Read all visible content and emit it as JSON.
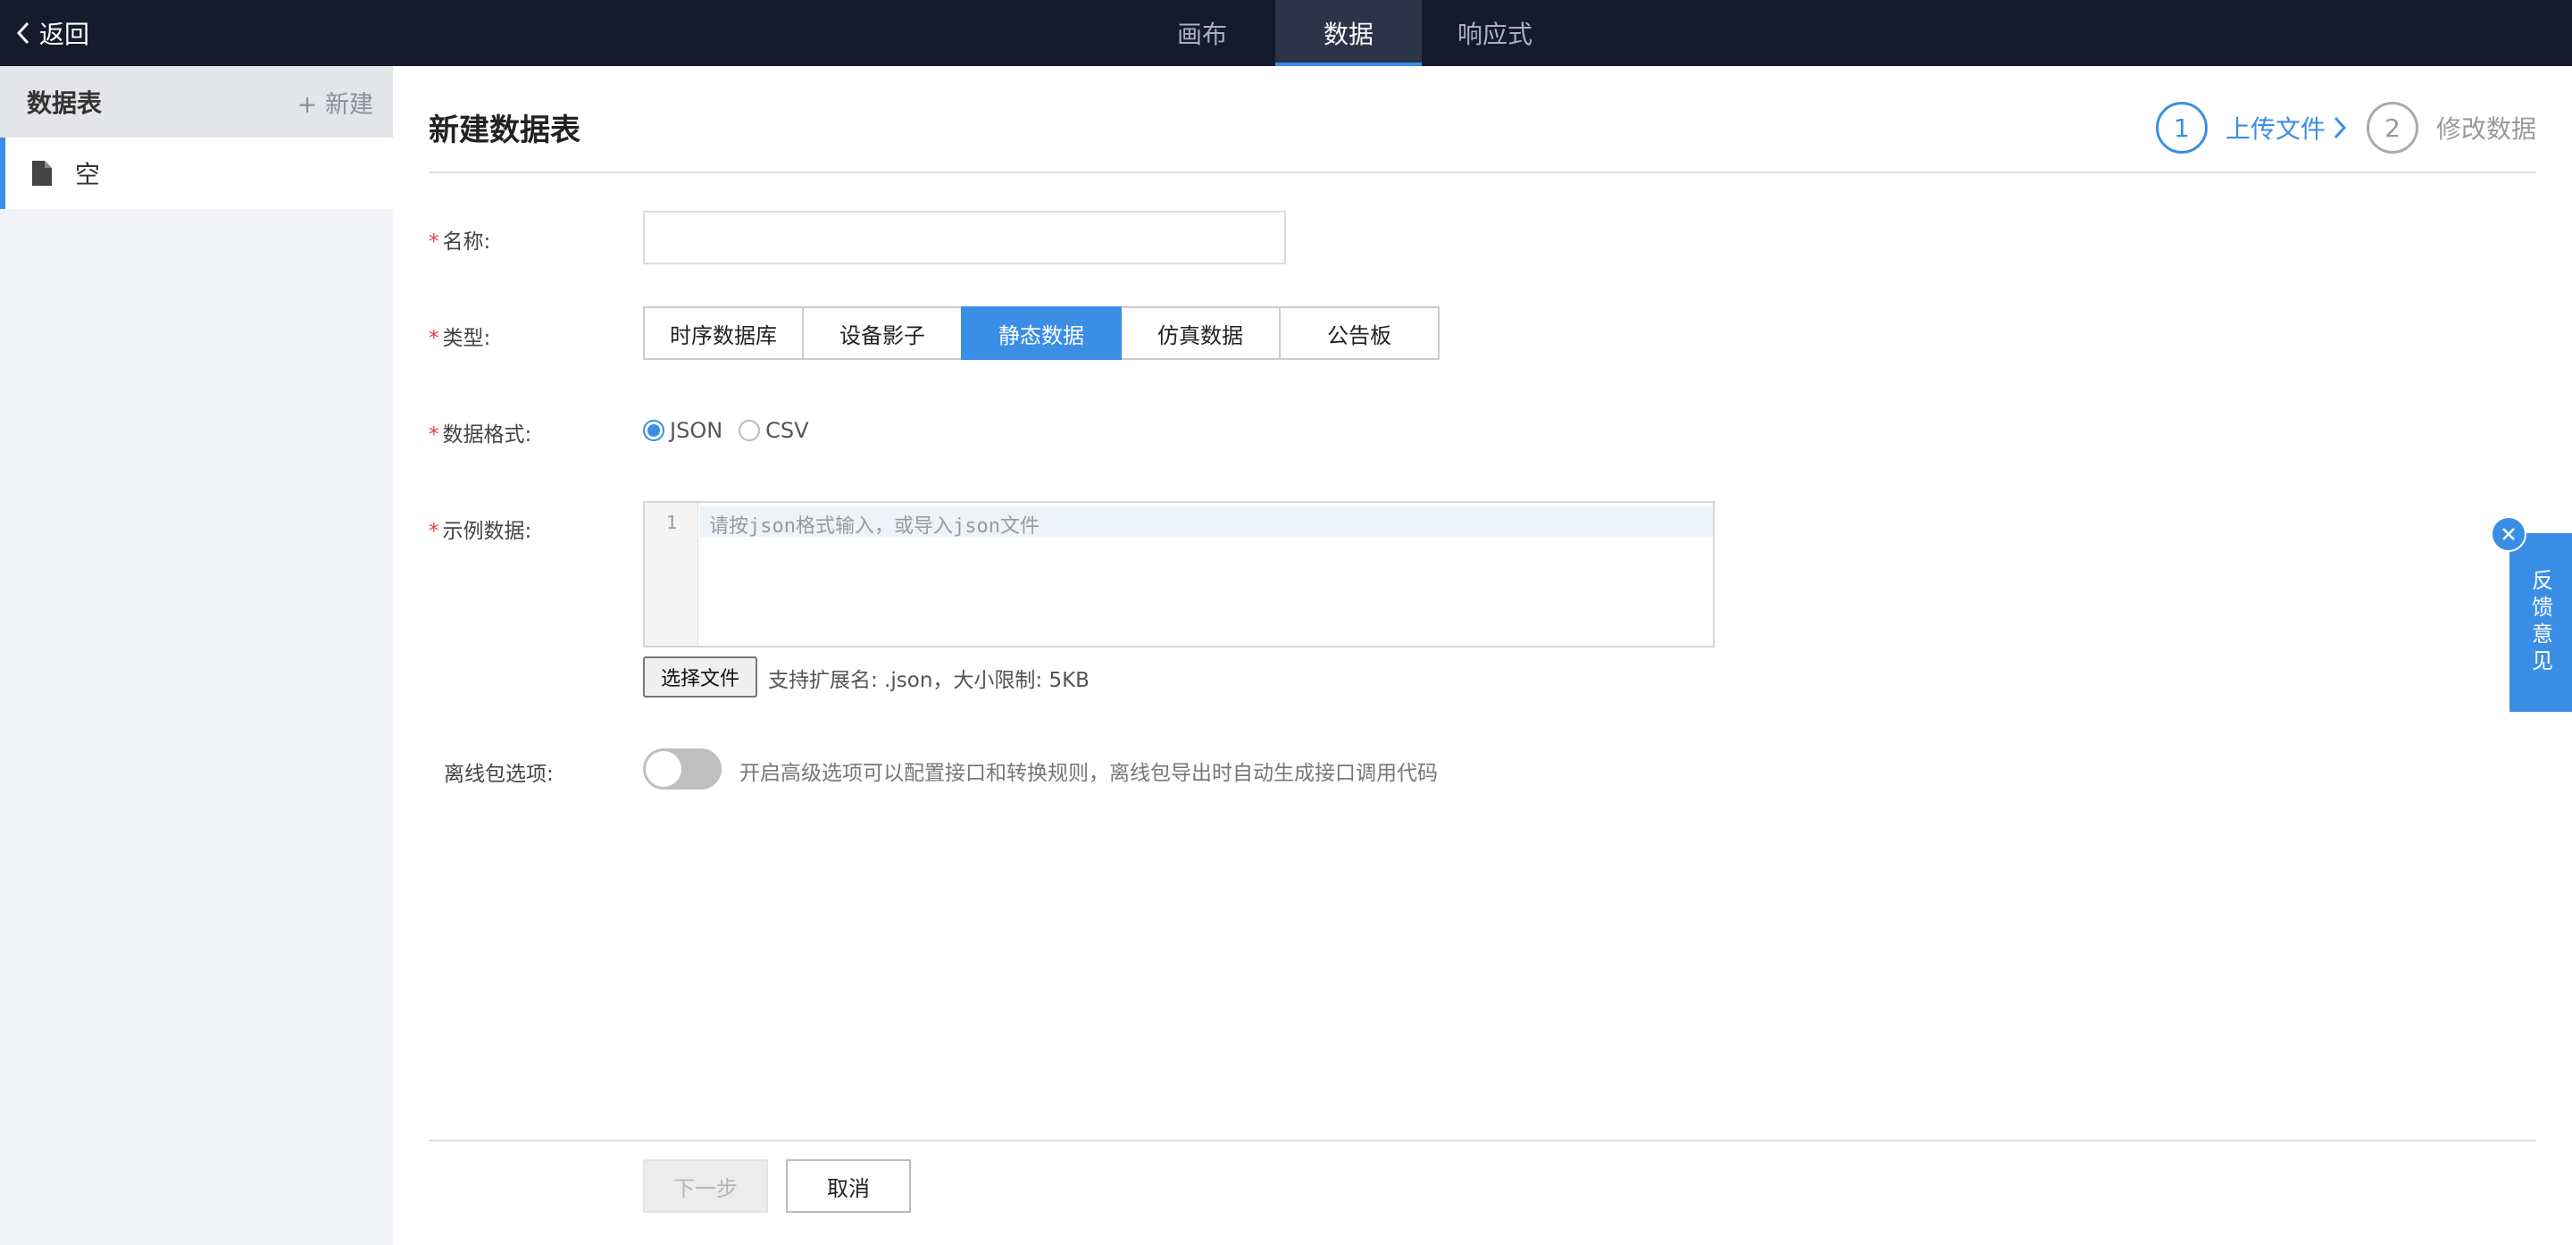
{
  "topbar": {
    "back_label": "返回",
    "tabs": [
      {
        "label": "画布",
        "active": false
      },
      {
        "label": "数据",
        "active": true
      },
      {
        "label": "响应式",
        "active": false
      }
    ]
  },
  "sidebar": {
    "title": "数据表",
    "new_label": "+ 新建",
    "items": [
      {
        "label": "空",
        "icon": "file-icon",
        "selected": true
      }
    ]
  },
  "main": {
    "title": "新建数据表",
    "steps": [
      {
        "number": "1",
        "label": "上传文件",
        "active": true
      },
      {
        "number": "2",
        "label": "修改数据",
        "active": false
      }
    ],
    "form": {
      "name_label": "名称:",
      "name_value": "",
      "type_label": "类型:",
      "types": [
        "时序数据库",
        "设备影子",
        "静态数据",
        "仿真数据",
        "公告板"
      ],
      "type_selected": "静态数据",
      "format_label": "数据格式:",
      "formats": [
        "JSON",
        "CSV"
      ],
      "format_selected": "JSON",
      "sample_label": "示例数据:",
      "editor_line_number": "1",
      "editor_placeholder": "请按json格式输入，或导入json文件",
      "file_button": "选择文件",
      "file_hint": "支持扩展名: .json，大小限制: 5KB",
      "offline_label": "离线包选项:",
      "offline_enabled": false,
      "offline_hint": "开启高级选项可以配置接口和转换规则，离线包导出时自动生成接口调用代码"
    },
    "footer": {
      "next_label": "下一步",
      "cancel_label": "取消"
    }
  },
  "feedback": {
    "label": "反馈意见"
  },
  "colors": {
    "accent": "#3a8ee6",
    "topbar": "#151b2c",
    "required": "#e5413e"
  }
}
